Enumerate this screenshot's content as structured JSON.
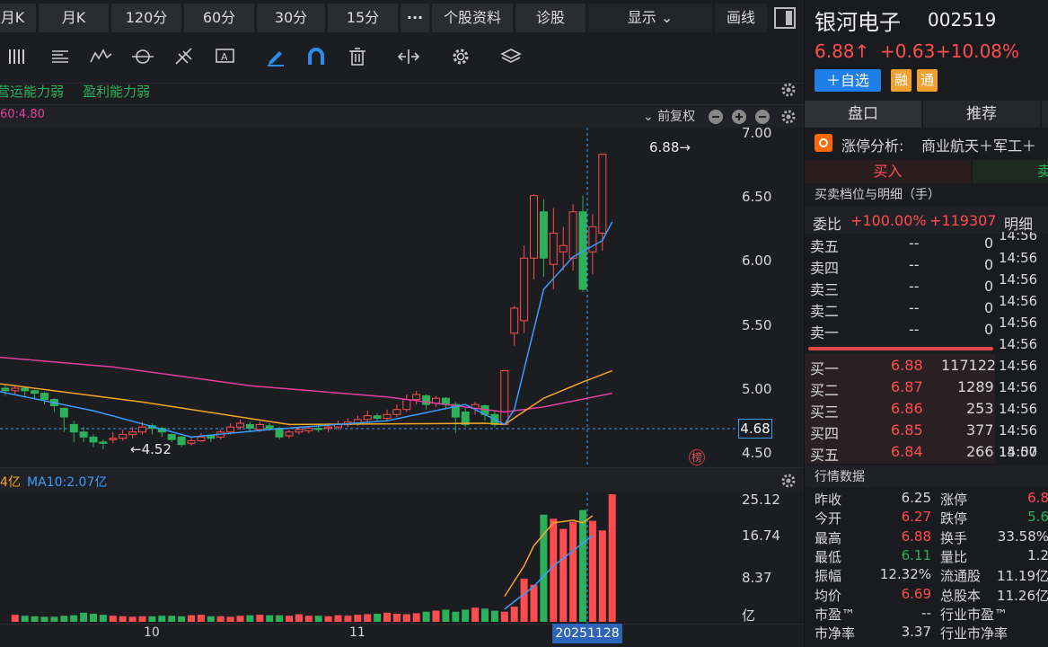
{
  "toolbar": {
    "tabs": [
      "月K",
      "月K",
      "120分",
      "60分",
      "30分",
      "15分",
      "···",
      "个股资料",
      "诊股"
    ],
    "display": "显示",
    "draw": "画线"
  },
  "indicators": {
    "item1": "营运能力弱",
    "item2": "盈利能力弱"
  },
  "ma_label": "60:4.80",
  "adjust": "前复权",
  "y_axis": [
    "7.00",
    "6.50",
    "6.00",
    "5.50",
    "5.00",
    "4.50"
  ],
  "last_price_tag": "4.68",
  "high_mark": "6.88→",
  "low_mark": "←4.52",
  "bang": "榜",
  "volume": {
    "label1": "4亿",
    "label2": "MA10:2.07亿",
    "axis": [
      "25.12",
      "16.74",
      "8.37",
      "亿"
    ]
  },
  "x_axis": {
    "m10": "10",
    "m11": "11",
    "cursor_date": "20251128"
  },
  "stock": {
    "name": "银河电子",
    "code": "002519",
    "price": "6.88↑",
    "change": "+0.63",
    "pct": "+10.08%",
    "add": "＋自选",
    "rong": "融",
    "tong": "通"
  },
  "panel_tabs": {
    "pankou": "盘口",
    "tuijian": "推荐"
  },
  "limit_analysis": {
    "label": "涨停分析:",
    "text": "商业航天＋军工＋"
  },
  "buy_label": "买入",
  "sell_label": "卖",
  "book_title": "买卖档位与明细（手）",
  "ratio": {
    "label": "委比",
    "pct": "+100.00%",
    "diff": "+119307",
    "detail": "明细"
  },
  "asks": [
    {
      "name": "卖五",
      "price": "--",
      "vol": "0"
    },
    {
      "name": "卖四",
      "price": "--",
      "vol": "0"
    },
    {
      "name": "卖三",
      "price": "--",
      "vol": "0"
    },
    {
      "name": "卖二",
      "price": "--",
      "vol": "0"
    },
    {
      "name": "卖一",
      "price": "--",
      "vol": "0"
    }
  ],
  "bids": [
    {
      "name": "买一",
      "price": "6.88",
      "vol": "117122"
    },
    {
      "name": "买二",
      "price": "6.87",
      "vol": "1289"
    },
    {
      "name": "买三",
      "price": "6.86",
      "vol": "253"
    },
    {
      "name": "买四",
      "price": "6.85",
      "vol": "377"
    },
    {
      "name": "买五",
      "price": "6.84",
      "vol": "266"
    }
  ],
  "ticks": [
    "14:56",
    "14:56",
    "14:56",
    "14:56",
    "14:56",
    "14:56",
    "14:56",
    "14:56",
    "14:56",
    "14:56",
    "14:57",
    "15:00"
  ],
  "market_title": "行情数据",
  "quotes": [
    {
      "l1": "昨收",
      "v1": "6.25",
      "c1": "#d8d8d8",
      "l2": "涨停",
      "v2": "6.8",
      "c2": "#ff4d4f"
    },
    {
      "l1": "今开",
      "v1": "6.27",
      "c1": "#ff4d4f",
      "l2": "跌停",
      "v2": "5.6",
      "c2": "#2cb05a"
    },
    {
      "l1": "最高",
      "v1": "6.88",
      "c1": "#ff4d4f",
      "l2": "换手",
      "v2": "33.58%",
      "c2": "#d8d8d8"
    },
    {
      "l1": "最低",
      "v1": "6.11",
      "c1": "#2cb05a",
      "l2": "量比",
      "v2": "1.2",
      "c2": "#d8d8d8"
    },
    {
      "l1": "振幅",
      "v1": "12.32%",
      "c1": "#d8d8d8",
      "l2": "流通股",
      "v2": "11.19亿",
      "c2": "#d8d8d8"
    },
    {
      "l1": "均价",
      "v1": "6.69",
      "c1": "#ff4d4f",
      "l2": "总股本",
      "v2": "11.26亿",
      "c2": "#d8d8d8"
    },
    {
      "l1": "市盈™",
      "v1": "--",
      "c1": "#d8d8d8",
      "l2": "行业市盈™",
      "v2": "",
      "c2": "#d8d8d8"
    },
    {
      "l1": "市净率",
      "v1": "3.37",
      "c1": "#d8d8d8",
      "l2": "行业市净率",
      "v2": "",
      "c2": "#d8d8d8"
    }
  ],
  "colors": {
    "up": "#ff4d4f",
    "down": "#2cb05a",
    "ma5": "#3b9cff",
    "ma10": "#f5a623",
    "ma20": "#e040a0",
    "bg": "#1c1d21"
  },
  "chart_data": {
    "type": "candlestick",
    "ylim": [
      4.45,
      7.05
    ],
    "candles": [
      {
        "o": 4.98,
        "c": 5.02,
        "h": 5.05,
        "l": 4.95
      },
      {
        "o": 5.01,
        "c": 4.99,
        "h": 5.04,
        "l": 4.95
      },
      {
        "o": 4.99,
        "c": 5.01,
        "h": 5.03,
        "l": 4.96
      },
      {
        "o": 5.01,
        "c": 4.99,
        "h": 5.02,
        "l": 4.94
      },
      {
        "o": 4.99,
        "c": 4.97,
        "h": 5.0,
        "l": 4.93
      },
      {
        "o": 4.97,
        "c": 4.92,
        "h": 4.98,
        "l": 4.88
      },
      {
        "o": 4.92,
        "c": 4.87,
        "h": 4.93,
        "l": 4.82
      },
      {
        "o": 4.85,
        "c": 4.78,
        "h": 4.85,
        "l": 4.66
      },
      {
        "o": 4.72,
        "c": 4.66,
        "h": 4.75,
        "l": 4.58
      },
      {
        "o": 4.66,
        "c": 4.62,
        "h": 4.7,
        "l": 4.58
      },
      {
        "o": 4.62,
        "c": 4.58,
        "h": 4.64,
        "l": 4.54
      },
      {
        "o": 4.58,
        "c": 4.57,
        "h": 4.6,
        "l": 4.52
      },
      {
        "o": 4.6,
        "c": 4.61,
        "h": 4.66,
        "l": 4.57
      },
      {
        "o": 4.61,
        "c": 4.64,
        "h": 4.68,
        "l": 4.59
      },
      {
        "o": 4.64,
        "c": 4.66,
        "h": 4.7,
        "l": 4.61
      },
      {
        "o": 4.66,
        "c": 4.7,
        "h": 4.74,
        "l": 4.64
      },
      {
        "o": 4.71,
        "c": 4.69,
        "h": 4.73,
        "l": 4.64
      },
      {
        "o": 4.69,
        "c": 4.66,
        "h": 4.7,
        "l": 4.62
      },
      {
        "o": 4.64,
        "c": 4.6,
        "h": 4.65,
        "l": 4.58
      },
      {
        "o": 4.62,
        "c": 4.56,
        "h": 4.63,
        "l": 4.54
      },
      {
        "o": 4.57,
        "c": 4.59,
        "h": 4.62,
        "l": 4.55
      },
      {
        "o": 4.59,
        "c": 4.62,
        "h": 4.65,
        "l": 4.58
      },
      {
        "o": 4.63,
        "c": 4.61,
        "h": 4.64,
        "l": 4.58
      },
      {
        "o": 4.62,
        "c": 4.66,
        "h": 4.68,
        "l": 4.6
      },
      {
        "o": 4.66,
        "c": 4.7,
        "h": 4.73,
        "l": 4.64
      },
      {
        "o": 4.7,
        "c": 4.73,
        "h": 4.76,
        "l": 4.68
      },
      {
        "o": 4.72,
        "c": 4.69,
        "h": 4.74,
        "l": 4.66
      },
      {
        "o": 4.68,
        "c": 4.72,
        "h": 4.74,
        "l": 4.66
      },
      {
        "o": 4.71,
        "c": 4.69,
        "h": 4.73,
        "l": 4.67
      },
      {
        "o": 4.69,
        "c": 4.62,
        "h": 4.7,
        "l": 4.6
      },
      {
        "o": 4.63,
        "c": 4.66,
        "h": 4.68,
        "l": 4.61
      },
      {
        "o": 4.66,
        "c": 4.68,
        "h": 4.7,
        "l": 4.64
      },
      {
        "o": 4.67,
        "c": 4.69,
        "h": 4.71,
        "l": 4.65
      },
      {
        "o": 4.69,
        "c": 4.68,
        "h": 4.72,
        "l": 4.66
      },
      {
        "o": 4.69,
        "c": 4.7,
        "h": 4.73,
        "l": 4.66
      },
      {
        "o": 4.7,
        "c": 4.72,
        "h": 4.75,
        "l": 4.68
      },
      {
        "o": 4.72,
        "c": 4.74,
        "h": 4.77,
        "l": 4.7
      },
      {
        "o": 4.73,
        "c": 4.76,
        "h": 4.79,
        "l": 4.71
      },
      {
        "o": 4.76,
        "c": 4.79,
        "h": 4.83,
        "l": 4.74
      },
      {
        "o": 4.79,
        "c": 4.77,
        "h": 4.81,
        "l": 4.74
      },
      {
        "o": 4.77,
        "c": 4.8,
        "h": 4.84,
        "l": 4.75
      },
      {
        "o": 4.8,
        "c": 4.84,
        "h": 4.88,
        "l": 4.78
      },
      {
        "o": 4.84,
        "c": 4.92,
        "h": 4.96,
        "l": 4.82
      },
      {
        "o": 4.92,
        "c": 4.96,
        "h": 4.99,
        "l": 4.88
      },
      {
        "o": 4.95,
        "c": 4.88,
        "h": 4.96,
        "l": 4.84
      },
      {
        "o": 4.89,
        "c": 4.93,
        "h": 4.95,
        "l": 4.86
      },
      {
        "o": 4.93,
        "c": 4.88,
        "h": 4.94,
        "l": 4.84
      },
      {
        "o": 4.88,
        "c": 4.78,
        "h": 4.9,
        "l": 4.65
      },
      {
        "o": 4.82,
        "c": 4.72,
        "h": 4.85,
        "l": 4.7
      },
      {
        "o": 4.85,
        "c": 4.88,
        "h": 4.9,
        "l": 4.8
      },
      {
        "o": 4.87,
        "c": 4.8,
        "h": 4.88,
        "l": 4.75
      },
      {
        "o": 4.8,
        "c": 4.72,
        "h": 4.83,
        "l": 4.7
      },
      {
        "o": 4.72,
        "c": 5.15,
        "h": 5.15,
        "l": 4.72
      },
      {
        "o": 5.45,
        "c": 5.65,
        "h": 5.67,
        "l": 5.35
      },
      {
        "o": 5.55,
        "c": 6.05,
        "h": 6.15,
        "l": 5.45
      },
      {
        "o": 6.05,
        "c": 6.55,
        "h": 6.56,
        "l": 5.88
      },
      {
        "o": 6.42,
        "c": 6.05,
        "h": 6.52,
        "l": 5.9
      },
      {
        "o": 6.0,
        "c": 6.25,
        "h": 6.45,
        "l": 5.8
      },
      {
        "o": 6.1,
        "c": 6.15,
        "h": 6.3,
        "l": 5.95
      },
      {
        "o": 6.05,
        "c": 6.42,
        "h": 6.48,
        "l": 5.95
      },
      {
        "o": 6.42,
        "c": 5.8,
        "h": 6.55,
        "l": 5.78
      },
      {
        "o": 6.1,
        "c": 6.3,
        "h": 6.4,
        "l": 5.92
      },
      {
        "o": 6.25,
        "c": 6.88,
        "h": 6.88,
        "l": 6.11
      }
    ],
    "ma5": [
      [
        0,
        4.99
      ],
      [
        10,
        4.83
      ],
      [
        20,
        4.62
      ],
      [
        28,
        4.68
      ],
      [
        40,
        4.75
      ],
      [
        48,
        4.88
      ],
      [
        52,
        4.72
      ],
      [
        53,
        4.84
      ],
      [
        56,
        5.8
      ],
      [
        59,
        6.06
      ],
      [
        62,
        6.19
      ],
      [
        63,
        6.34
      ]
    ],
    "ma10": [
      [
        0,
        5.05
      ],
      [
        15,
        4.9
      ],
      [
        30,
        4.72
      ],
      [
        50,
        4.73
      ],
      [
        52,
        4.72
      ],
      [
        56,
        4.93
      ],
      [
        60,
        5.06
      ],
      [
        63,
        5.15
      ]
    ],
    "ma20": [
      [
        0,
        5.26
      ],
      [
        12,
        5.18
      ],
      [
        26,
        5.03
      ],
      [
        40,
        4.94
      ],
      [
        52,
        4.82
      ],
      [
        56,
        4.86
      ],
      [
        63,
        4.97
      ]
    ],
    "volume": [
      1.4,
      1.2,
      1.1,
      1.0,
      1.0,
      1.2,
      1.3,
      1.8,
      1.6,
      1.4,
      1.2,
      1.1,
      1.0,
      1.1,
      1.1,
      1.2,
      1.2,
      1.1,
      1.3,
      1.4,
      1.1,
      1.1,
      1.0,
      1.2,
      1.3,
      1.4,
      1.3,
      1.3,
      1.2,
      1.5,
      1.2,
      1.2,
      1.1,
      1.3,
      1.2,
      1.4,
      1.5,
      1.6,
      1.8,
      1.6,
      1.5,
      1.7,
      2.0,
      2.2,
      2.4,
      2.0,
      2.4,
      2.8,
      2.6,
      2.2,
      2.0,
      3.0,
      8.5,
      7.3,
      21.1,
      20.3,
      18.3,
      19.7,
      22.0,
      19.9,
      18.0,
      25.12
    ],
    "vol_ma5": [
      [
        52,
        5.0
      ],
      [
        54,
        11.0
      ],
      [
        55,
        15.0
      ],
      [
        57,
        19.5
      ],
      [
        59,
        20.0
      ],
      [
        60,
        19.5
      ],
      [
        61,
        20.9
      ]
    ],
    "vol_ma10": [
      [
        52,
        2.5
      ],
      [
        55,
        7.0
      ],
      [
        57,
        11.0
      ],
      [
        59,
        14.0
      ],
      [
        61,
        17.0
      ]
    ],
    "vol_ylim": [
      0,
      25.12
    ]
  }
}
